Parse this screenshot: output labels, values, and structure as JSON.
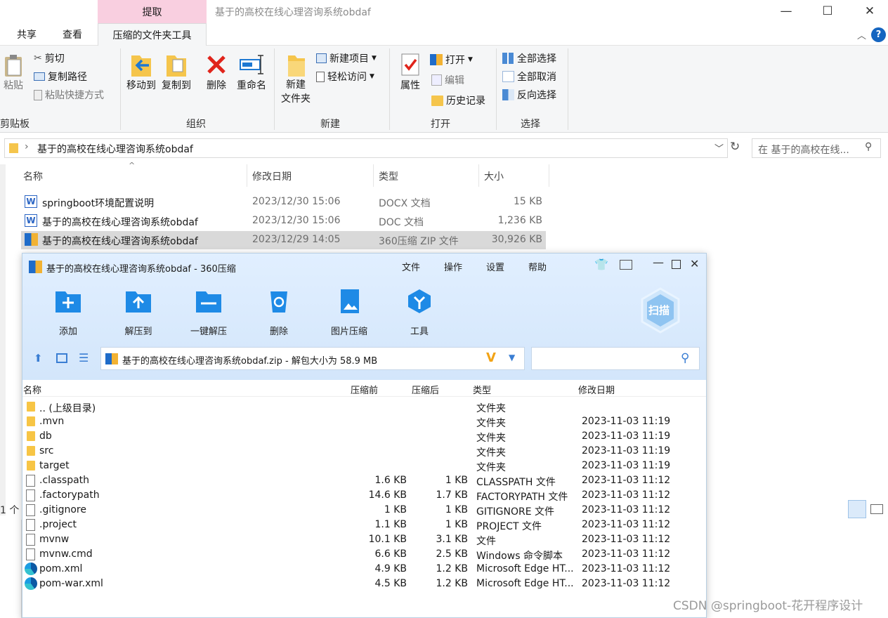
{
  "explorer": {
    "context_tab_header": "提取",
    "window_title": "基于的高校在线心理咨询系统obdaf",
    "tabs": [
      "共享",
      "查看",
      "压缩的文件夹工具"
    ],
    "ribbon": {
      "clipboard": {
        "label": "剪贴板",
        "paste": "粘贴",
        "cut": "剪切",
        "copy_path": "复制路径",
        "paste_shortcut": "粘贴快捷方式"
      },
      "organize": {
        "label": "组织",
        "move_to": "移动到",
        "copy_to": "复制到",
        "delete": "删除",
        "rename": "重命名"
      },
      "new": {
        "label": "新建",
        "new_folder": "新建\n文件夹",
        "new_item": "新建项目",
        "easy_access": "轻松访问"
      },
      "open": {
        "label": "打开",
        "properties": "属性",
        "open": "打开",
        "edit": "编辑",
        "history": "历史记录"
      },
      "select": {
        "label": "选择",
        "select_all": "全部选择",
        "select_none": "全部取消",
        "invert": "反向选择"
      }
    },
    "address_path": "基于的高校在线心理咨询系统obdaf",
    "search_placeholder": "在 基于的高校在线...",
    "columns": {
      "name": "名称",
      "date": "修改日期",
      "type": "类型",
      "size": "大小"
    },
    "files": [
      {
        "name": "springboot环境配置说明",
        "date": "2023/12/30 15:06",
        "type": "DOCX 文档",
        "size": "15 KB",
        "icon": "word-icon"
      },
      {
        "name": "基于的高校在线心理咨询系统obdaf",
        "date": "2023/12/30 15:06",
        "type": "DOC 文档",
        "size": "1,236 KB",
        "icon": "word-icon"
      },
      {
        "name": "基于的高校在线心理咨询系统obdaf",
        "date": "2023/12/29 14:05",
        "type": "360压缩 ZIP 文件",
        "size": "30,926 KB",
        "icon": "zip-icon",
        "selected": true
      }
    ],
    "status_fragment": "1 个"
  },
  "zip": {
    "title": "基于的高校在线心理咨询系统obdaf - 360压缩",
    "menu": [
      "文件",
      "操作",
      "设置",
      "帮助"
    ],
    "tools": [
      "添加",
      "解压到",
      "一键解压",
      "删除",
      "图片压缩",
      "工具"
    ],
    "scan_label": "扫描",
    "path": "基于的高校在线心理咨询系统obdaf.zip - 解包大小为 58.9 MB",
    "columns": {
      "name": "名称",
      "before": "压缩前",
      "after": "压缩后",
      "type": "类型",
      "date": "修改日期"
    },
    "rows": [
      {
        "name": ".. (上级目录)",
        "before": "",
        "after": "",
        "type": "文件夹",
        "date": "",
        "icon": "folder"
      },
      {
        "name": ".mvn",
        "before": "",
        "after": "",
        "type": "文件夹",
        "date": "2023-11-03 11:19",
        "icon": "folder"
      },
      {
        "name": "db",
        "before": "",
        "after": "",
        "type": "文件夹",
        "date": "2023-11-03 11:19",
        "icon": "folder"
      },
      {
        "name": "src",
        "before": "",
        "after": "",
        "type": "文件夹",
        "date": "2023-11-03 11:19",
        "icon": "folder"
      },
      {
        "name": "target",
        "before": "",
        "after": "",
        "type": "文件夹",
        "date": "2023-11-03 11:19",
        "icon": "folder"
      },
      {
        "name": ".classpath",
        "before": "1.6 KB",
        "after": "1 KB",
        "type": "CLASSPATH 文件",
        "date": "2023-11-03 11:12",
        "icon": "doc"
      },
      {
        "name": ".factorypath",
        "before": "14.6 KB",
        "after": "1.7 KB",
        "type": "FACTORYPATH 文件",
        "date": "2023-11-03 11:12",
        "icon": "doc"
      },
      {
        "name": ".gitignore",
        "before": "1 KB",
        "after": "1 KB",
        "type": "GITIGNORE 文件",
        "date": "2023-11-03 11:12",
        "icon": "doc"
      },
      {
        "name": ".project",
        "before": "1.1 KB",
        "after": "1 KB",
        "type": "PROJECT 文件",
        "date": "2023-11-03 11:12",
        "icon": "doc"
      },
      {
        "name": "mvnw",
        "before": "10.1 KB",
        "after": "3.1 KB",
        "type": "文件",
        "date": "2023-11-03 11:12",
        "icon": "doc"
      },
      {
        "name": "mvnw.cmd",
        "before": "6.6 KB",
        "after": "2.5 KB",
        "type": "Windows 命令脚本",
        "date": "2023-11-03 11:12",
        "icon": "doc"
      },
      {
        "name": "pom.xml",
        "before": "4.9 KB",
        "after": "1.2 KB",
        "type": "Microsoft Edge HT...",
        "date": "2023-11-03 11:12",
        "icon": "edge"
      },
      {
        "name": "pom-war.xml",
        "before": "4.5 KB",
        "after": "1.2 KB",
        "type": "Microsoft Edge HT...",
        "date": "2023-11-03 11:12",
        "icon": "edge"
      }
    ]
  },
  "watermark": "CSDN @springboot-花开程序设计"
}
